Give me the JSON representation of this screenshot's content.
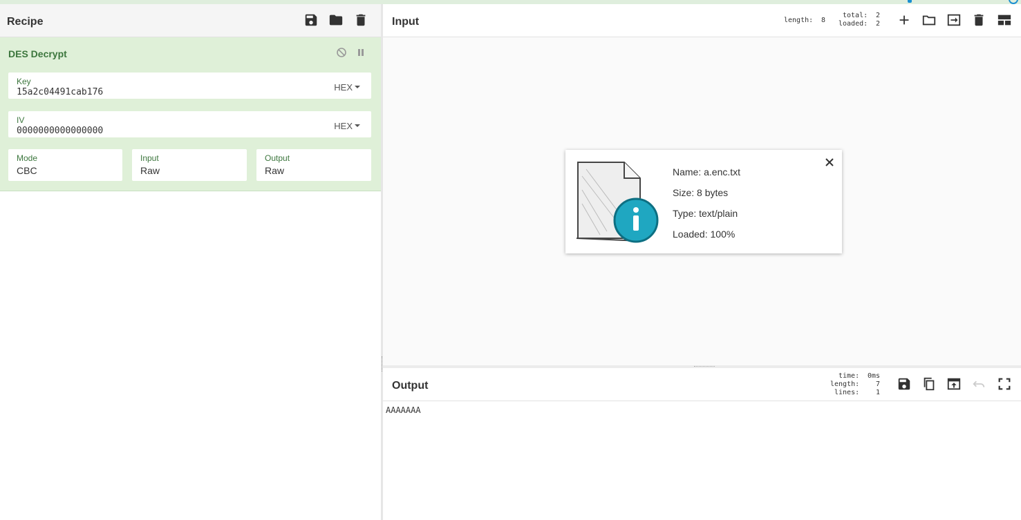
{
  "recipe": {
    "title": "Recipe",
    "operation": {
      "name": "DES Decrypt",
      "key": {
        "label": "Key",
        "value": "15a2c04491cab176",
        "encoding": "HEX"
      },
      "iv": {
        "label": "IV",
        "value": "0000000000000000",
        "encoding": "HEX"
      },
      "mode": {
        "label": "Mode",
        "value": "CBC"
      },
      "input": {
        "label": "Input",
        "value": "Raw"
      },
      "output": {
        "label": "Output",
        "value": "Raw"
      }
    }
  },
  "input": {
    "title": "Input",
    "stats": {
      "length_label": "length:",
      "length": "8",
      "total_label": "total:",
      "total": "2",
      "loaded_label": "loaded:",
      "loaded": "2"
    },
    "file": {
      "name": "Name: a.enc.txt",
      "size": "Size: 8 bytes",
      "type": "Type: text/plain",
      "loaded": "Loaded: 100%"
    }
  },
  "output": {
    "title": "Output",
    "stats": {
      "time_label": "time:",
      "time": "0ms",
      "length_label": "length:",
      "length": "7",
      "lines_label": "lines:",
      "lines": "1"
    },
    "text": "AAAAAAA"
  },
  "colors": {
    "op_background": "#dff0d8",
    "op_text": "#3c763d",
    "accent_blue": "#1a8fd1",
    "info_teal": "#1fa7c1"
  }
}
